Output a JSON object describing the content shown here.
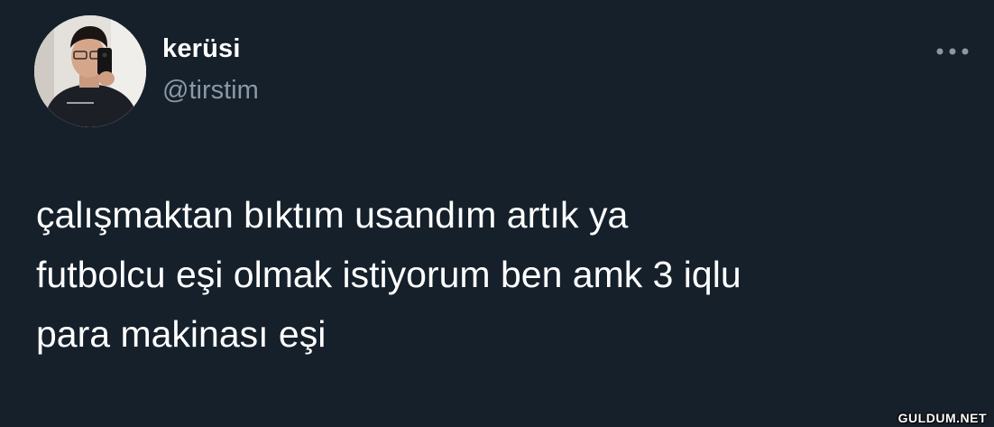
{
  "user": {
    "display_name": "kerüsi",
    "handle": "@tirstim"
  },
  "tweet": {
    "lines": [
      "çalışmaktan bıktım usandım artık ya",
      "futbolcu eşi olmak istiyorum ben amk 3 iqlu",
      "para makinası eşi"
    ]
  },
  "icons": {
    "more": "more-horizontal-icon",
    "avatar": "profile-photo"
  },
  "watermark": "GULDUM.NET",
  "colors": {
    "background": "#15202b",
    "text_primary": "#ffffff",
    "text_secondary": "#8899a6"
  }
}
